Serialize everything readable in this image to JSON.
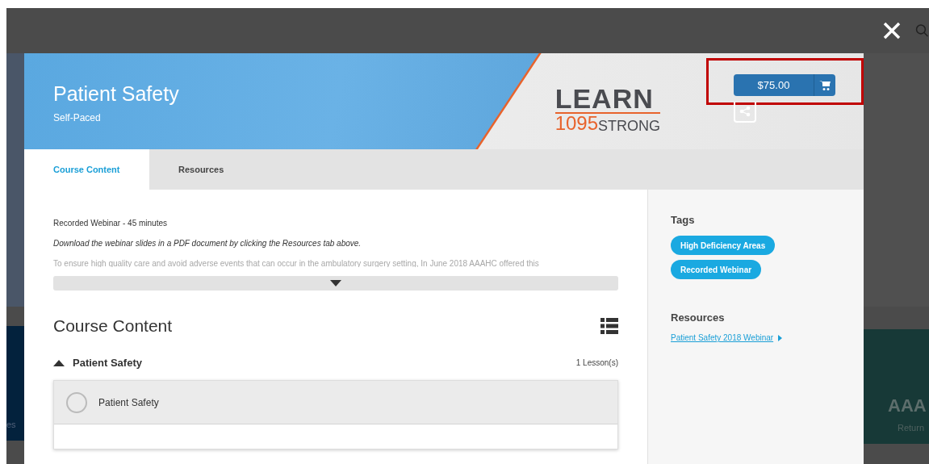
{
  "backdrop": {
    "left_text": "es",
    "right_title": "AAA",
    "right_subtitle": "Return"
  },
  "course": {
    "title": "Patient Safety",
    "subtitle": "Self-Paced"
  },
  "logo": {
    "word": "LEARN",
    "number": "1095",
    "tagline": "STRONG"
  },
  "price": {
    "label": "$75.00",
    "highlighted": true
  },
  "tabs": [
    {
      "label": "Course Content",
      "selected": true
    },
    {
      "label": "Resources",
      "selected": false
    }
  ],
  "description": [
    {
      "text": "Recorded Webinar - 45 minutes",
      "kind": "plain"
    },
    {
      "text": "Download the webinar slides in a PDF document by clicking the Resources tab above.",
      "kind": "italic"
    },
    {
      "text": "To ensure high quality care and avoid adverse events that can occur in the ambulatory surgery setting, In June 2018 AAAHC offered this",
      "kind": "faded"
    }
  ],
  "content": {
    "heading": "Course Content",
    "modules": [
      {
        "title": "Patient Safety",
        "count": "1 Lesson(s)",
        "expanded": true,
        "lessons": [
          {
            "title": "Patient Safety",
            "completed": false
          }
        ]
      }
    ]
  },
  "sidebar": {
    "tags_heading": "Tags",
    "tags": [
      "High Deficiency Areas",
      "Recorded Webinar"
    ],
    "resources_heading": "Resources",
    "resources": [
      "Patient Safety 2018 Webinar"
    ]
  }
}
